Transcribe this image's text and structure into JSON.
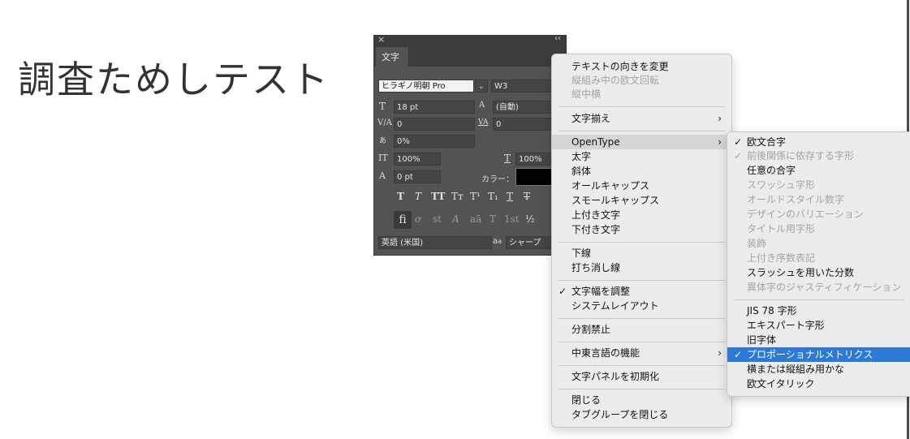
{
  "canvas": {
    "text": "調査ためしテスト"
  },
  "panel": {
    "close": "×",
    "collapse": "‹‹",
    "tab": "文字",
    "menu_icon": "≡",
    "font_family": "ヒラギノ明朝 Pro",
    "font_style": "W3",
    "font_size": "18 pt",
    "leading": "(自動)",
    "kerning": "0",
    "tracking": "0",
    "tsume": "0%",
    "vscale": "100%",
    "hscale": "100%",
    "baseline": "0 pt",
    "color_label": "カラー：",
    "language": "英語 (米国)",
    "aa_label": "a",
    "aa_sub": "a",
    "aa": "シャープ",
    "style_buttons": [
      "T",
      "T",
      "TT",
      "Tт",
      "T¹",
      "T₁",
      "T",
      "T"
    ],
    "opentype_buttons": [
      "fi",
      "ơ",
      "st",
      "A",
      "aā",
      "T",
      "1st",
      "½"
    ],
    "icons": {
      "size": "T",
      "leading": "A",
      "kerning": "V/A",
      "tracking": "VA",
      "tsume": "あ",
      "vscale": "IT",
      "hscale": "T",
      "baseline": "A"
    }
  },
  "main_menu": {
    "items": [
      {
        "label": "テキストの向きを変更"
      },
      {
        "label": "縦組み中の欧文回転"
      },
      {
        "label": "縦中横"
      },
      {
        "label": "文字揃え",
        "arrow": "›"
      },
      {
        "label": "OpenType",
        "arrow": "›"
      },
      {
        "label": "太字"
      },
      {
        "label": "斜体"
      },
      {
        "label": "オールキャップス"
      },
      {
        "label": "スモールキャップス"
      },
      {
        "label": "上付き文字"
      },
      {
        "label": "下付き文字"
      },
      {
        "label": "下線"
      },
      {
        "label": "打ち消し線"
      },
      {
        "label": "文字幅を調整",
        "check": "✓"
      },
      {
        "label": "システムレイアウト"
      },
      {
        "label": "分割禁止"
      },
      {
        "label": "中東言語の機能",
        "arrow": "›"
      },
      {
        "label": "文字パネルを初期化"
      },
      {
        "label": "閉じる"
      },
      {
        "label": "タブグループを閉じる"
      }
    ]
  },
  "submenu": {
    "items": [
      {
        "label": "欧文合字",
        "check": "✓"
      },
      {
        "label": "前後関係に依存する字形",
        "check": "✓"
      },
      {
        "label": "任意の合字"
      },
      {
        "label": "スワッシュ字形"
      },
      {
        "label": "オールドスタイル数字"
      },
      {
        "label": "デザインのバリエーション"
      },
      {
        "label": "タイトル用字形"
      },
      {
        "label": "装飾"
      },
      {
        "label": "上付き序数表記"
      },
      {
        "label": "スラッシュを用いた分数"
      },
      {
        "label": "異体字のジャスティフィケーション"
      },
      {
        "label": "JIS 78 字形"
      },
      {
        "label": "エキスパート字形"
      },
      {
        "label": "旧字体"
      },
      {
        "label": "プロポーショナルメトリクス",
        "check": "✓"
      },
      {
        "label": "横または縦組み用かな"
      },
      {
        "label": "欧文イタリック"
      }
    ]
  }
}
